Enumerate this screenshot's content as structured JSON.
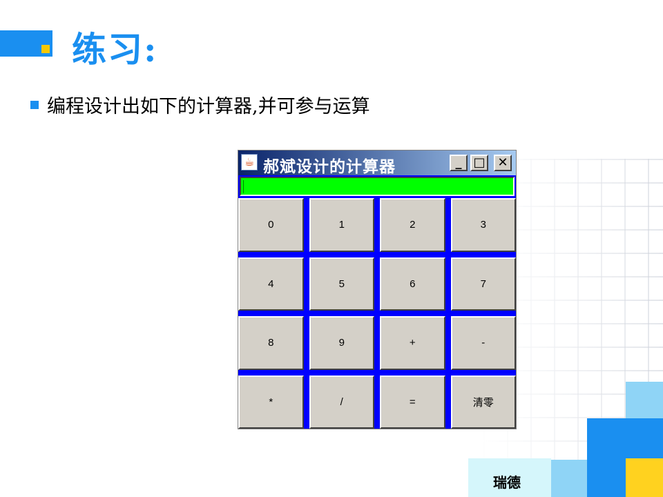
{
  "slide": {
    "title": "练习:",
    "bullet": "编程设计出如下的计算器,并可参与运算",
    "footer": "瑞德"
  },
  "window": {
    "title": "郝斌设计的计算器",
    "icon": "java-cup-icon",
    "controls": {
      "minimize": "_",
      "maximize": "□",
      "close": "✕"
    },
    "display_value": ""
  },
  "keys": [
    "0",
    "1",
    "2",
    "3",
    "4",
    "5",
    "6",
    "7",
    "8",
    "9",
    "+",
    "-",
    "*",
    "/",
    "=",
    "清零"
  ],
  "colors": {
    "accent": "#1a8ff0",
    "accent_yellow": "#f6c800",
    "display_bg": "#00ff00",
    "window_bg": "#0000ff",
    "button_face": "#d4d0c8"
  }
}
